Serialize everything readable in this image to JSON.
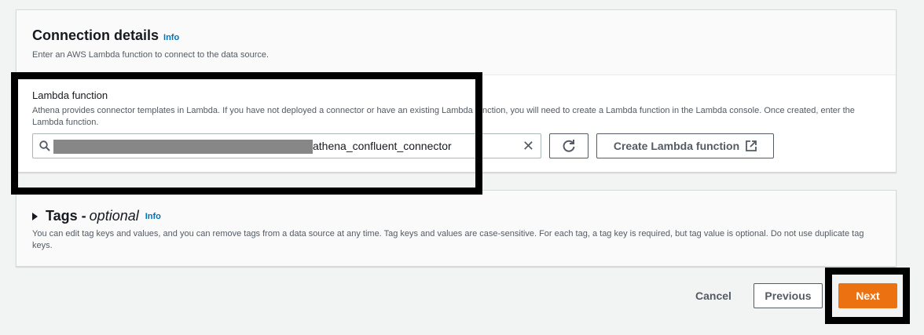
{
  "connection": {
    "title": "Connection details",
    "info": "Info",
    "description": "Enter an AWS Lambda function to connect to the data source.",
    "lambda_label": "Lambda function",
    "lambda_description": "Athena provides connector templates in Lambda. If you have not deployed a connector or have an existing Lambda function, you will need to create a Lambda function in the Lambda console. Once created, enter the Lambda function.",
    "lambda_value": "athena_confluent_connector",
    "create_button": "Create Lambda function"
  },
  "tags": {
    "title": "Tags - ",
    "optional": "optional",
    "info": "Info",
    "description": "You can edit tag keys and values, and you can remove tags from a data source at any time. Tag keys and values are case-sensitive. For each tag, a tag key is required, but tag value is optional. Do not use duplicate tag keys."
  },
  "footer": {
    "cancel": "Cancel",
    "previous": "Previous",
    "next": "Next"
  },
  "colors": {
    "primary": "#ec7211",
    "link": "#0073bb"
  }
}
